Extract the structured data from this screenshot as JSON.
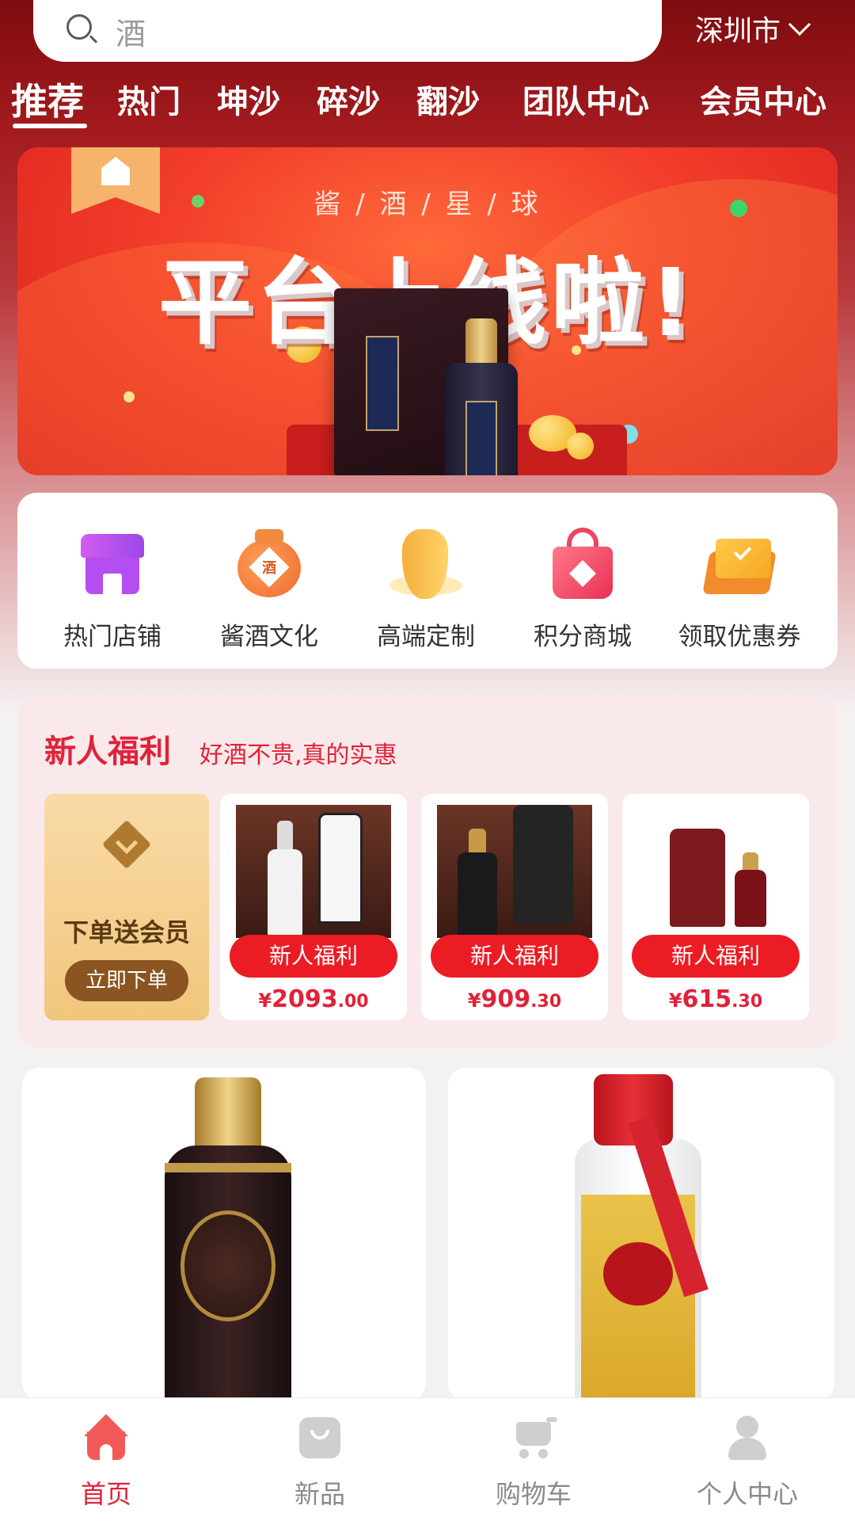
{
  "header": {
    "search_text": "酒",
    "city": "深圳市",
    "tabs": [
      "推荐",
      "热门",
      "坤沙",
      "碎沙",
      "翻沙",
      "团队中心",
      "会员中心"
    ]
  },
  "banner": {
    "subtitle": "酱 / 酒 / 星 / 球",
    "title": "平台上线啦!"
  },
  "quick_menu": [
    {
      "label": "热门店铺",
      "icon": "shop-icon"
    },
    {
      "label": "酱酒文化",
      "icon": "liquor-jar-icon",
      "icon_text": "酒"
    },
    {
      "label": "高端定制",
      "icon": "gourd-icon"
    },
    {
      "label": "积分商城",
      "icon": "shopping-bag-icon"
    },
    {
      "label": "领取优惠券",
      "icon": "coupon-icon"
    }
  ],
  "welfare": {
    "title": "新人福利",
    "subtitle": "好酒不贵,真的实惠",
    "member_card": {
      "text": "下单送会员",
      "button": "立即下单"
    },
    "items": [
      {
        "badge": "新人福利",
        "currency": "¥",
        "price_int": "2093",
        "price_dec": ".00"
      },
      {
        "badge": "新人福利",
        "currency": "¥",
        "price_int": "909",
        "price_dec": ".30"
      },
      {
        "badge": "新人福利",
        "currency": "¥",
        "price_int": "615",
        "price_dec": ".30"
      }
    ]
  },
  "bottom_nav": [
    {
      "label": "首页",
      "icon": "home-icon",
      "active": true
    },
    {
      "label": "新品",
      "icon": "new-bag-icon",
      "active": false
    },
    {
      "label": "购物车",
      "icon": "cart-icon",
      "active": false
    },
    {
      "label": "个人中心",
      "icon": "user-icon",
      "active": false
    }
  ],
  "colors": {
    "brand_red": "#e0223a",
    "header_dark": "#7d0c10",
    "badge_red": "#ec1c24",
    "member_gold": "#f1c67c"
  }
}
